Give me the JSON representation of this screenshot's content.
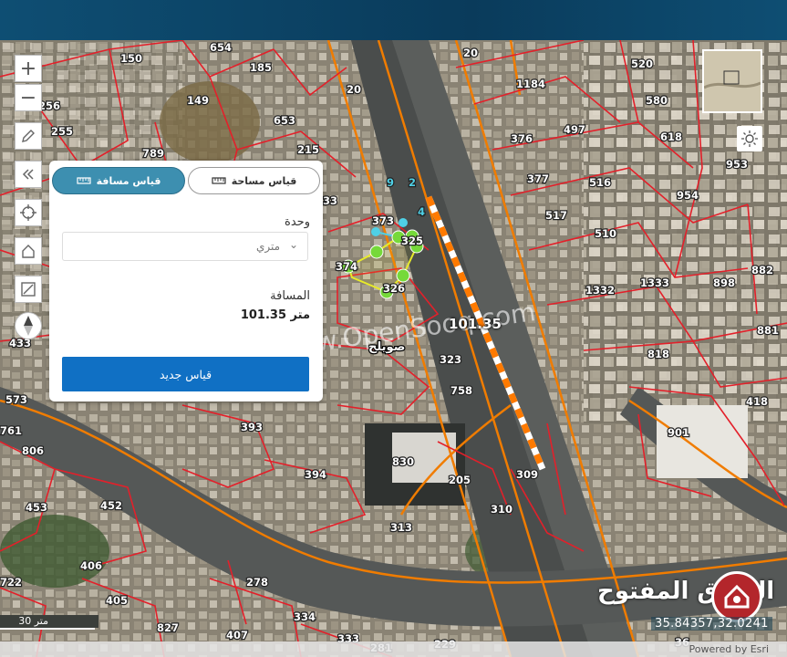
{
  "map": {
    "parcels": [
      {
        "label": "150"
      },
      {
        "label": "654"
      },
      {
        "label": "185"
      },
      {
        "label": "149"
      },
      {
        "label": "256"
      },
      {
        "label": "255"
      },
      {
        "label": "653"
      },
      {
        "label": "215"
      },
      {
        "label": "789"
      },
      {
        "label": "20"
      },
      {
        "label": "20"
      },
      {
        "label": "1184"
      },
      {
        "label": "520"
      },
      {
        "label": "580"
      },
      {
        "label": "497"
      },
      {
        "label": "618"
      },
      {
        "label": "376"
      },
      {
        "label": "377"
      },
      {
        "label": "953"
      },
      {
        "label": "516"
      },
      {
        "label": "954"
      },
      {
        "label": "517"
      },
      {
        "label": "510"
      },
      {
        "label": "1332"
      },
      {
        "label": "1333"
      },
      {
        "label": "898"
      },
      {
        "label": "882"
      },
      {
        "label": "881"
      },
      {
        "label": "818"
      },
      {
        "label": "418"
      },
      {
        "label": "901"
      },
      {
        "label": "373"
      },
      {
        "label": "325"
      },
      {
        "label": "374"
      },
      {
        "label": "326"
      },
      {
        "label": "323"
      },
      {
        "label": "758"
      },
      {
        "label": "433"
      },
      {
        "label": "573"
      },
      {
        "label": "761"
      },
      {
        "label": "806"
      },
      {
        "label": "393"
      },
      {
        "label": "394"
      },
      {
        "label": "830"
      },
      {
        "label": "205"
      },
      {
        "label": "309"
      },
      {
        "label": "310"
      },
      {
        "label": "453"
      },
      {
        "label": "452"
      },
      {
        "label": "406"
      },
      {
        "label": "313"
      },
      {
        "label": "722"
      },
      {
        "label": "405"
      },
      {
        "label": "278"
      },
      {
        "label": "334"
      },
      {
        "label": "827"
      },
      {
        "label": "407"
      },
      {
        "label": "333"
      },
      {
        "label": "281"
      },
      {
        "label": "229"
      },
      {
        "label": "33"
      },
      {
        "label": "36"
      }
    ],
    "measure_points": [
      "9",
      "2",
      "4"
    ],
    "measure_label": "101.35",
    "place_label": "صويلح",
    "watermark": "www.OpenSooq.com",
    "brand_name": "السوق المفتوح",
    "scale_label": "30 متر",
    "coordinates": "35.84357,32.0241",
    "attribution": "Powered by Esri",
    "page_index": "36"
  },
  "controls": {
    "zoom_in": "+",
    "zoom_out": "−"
  },
  "panel": {
    "tab_distance": "قياس مسافة",
    "tab_area": "قياس مساحة",
    "unit_label": "وحدة",
    "unit_value": "متري",
    "distance_label": "المسافة",
    "distance_value": "101.35 متر",
    "new_button": "قياس جديد"
  },
  "colors": {
    "header": "#0a3b5b",
    "accent": "#3d8fb0",
    "button": "#1070c4",
    "parcel_line": "#e3202a",
    "road_line": "#f07c00"
  }
}
